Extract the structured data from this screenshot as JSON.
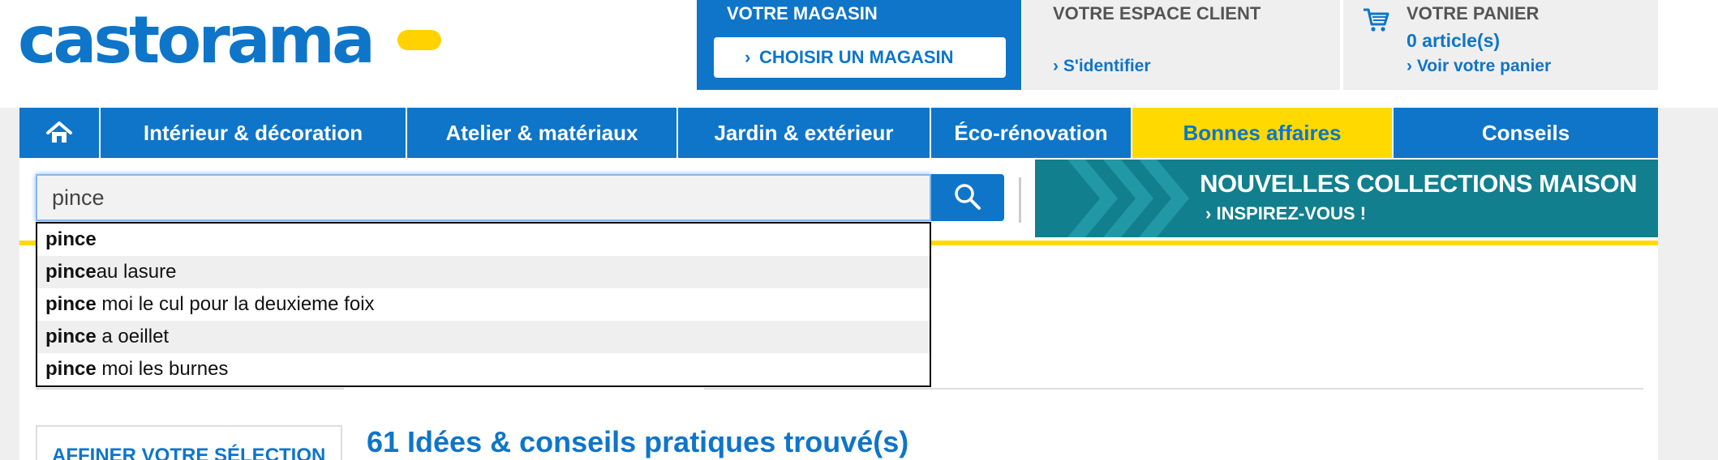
{
  "header": {
    "logo": "castorama",
    "store": {
      "title": "VOTRE MAGASIN",
      "button": "CHOISIR UN MAGASIN"
    },
    "client": {
      "title": "VOTRE ESPACE CLIENT",
      "link": "S'identifier"
    },
    "cart": {
      "title": "VOTRE PANIER",
      "count": "0 article(s)",
      "link": "Voir votre panier"
    }
  },
  "nav": {
    "items": [
      "Intérieur & décoration",
      "Atelier & matériaux",
      "Jardin & extérieur",
      "Éco-rénovation",
      "Bonnes affaires",
      "Conseils"
    ]
  },
  "search": {
    "value": "pince",
    "suggestions": [
      {
        "match": "pince",
        "rest": ""
      },
      {
        "match": "pince",
        "rest": "au lasure"
      },
      {
        "match": "pince",
        "rest": " moi le cul pour la deuxieme foix"
      },
      {
        "match": "pince",
        "rest": " a oeillet"
      },
      {
        "match": "pince",
        "rest": " moi les burnes"
      }
    ]
  },
  "banner": {
    "title": "NOUVELLES COLLECTIONS MAISON",
    "subtitle": "INSPIREZ-VOUS !"
  },
  "main": {
    "filter_title": "AFFINER VOTRE SÉLECTION",
    "results_title": "61 Idées & conseils pratiques trouvé(s)"
  },
  "colors": {
    "brand_blue": "#0e75c9",
    "brand_yellow": "#ffd900",
    "banner_teal": "#117f8e"
  },
  "icons": [
    "home-icon",
    "cart-icon",
    "search-icon",
    "chevron-right-icon"
  ]
}
